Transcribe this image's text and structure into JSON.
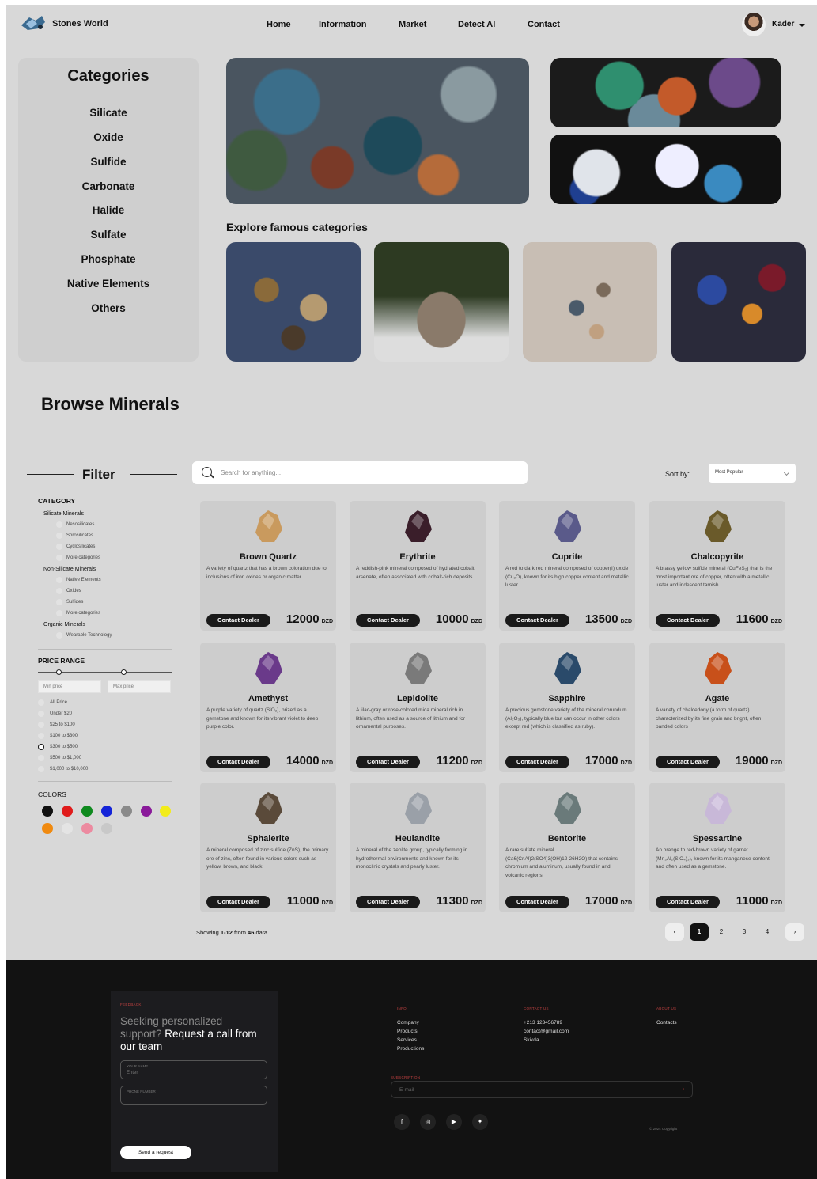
{
  "nav": {
    "brand": "Stones World",
    "links": [
      "Home",
      "Information",
      "Market",
      "Detect AI",
      "Contact"
    ],
    "user": "Kader"
  },
  "categories": {
    "title": "Categories",
    "items": [
      "Silicate",
      "Oxide",
      "Sulfide",
      "Carbonate",
      "Halide",
      "Sulfate",
      "Phosphate",
      "Native Elements",
      "Others"
    ]
  },
  "explore_title": "Explore famous categories",
  "browse_title": "Browse Minerals",
  "filter": {
    "title": "Filter",
    "category_heading": "CATEGORY",
    "groups": [
      {
        "label": "Silicate Minerals",
        "options": [
          "Nesosilicates",
          "Sorosilicates",
          "Cyclosilicates",
          "More categories"
        ]
      },
      {
        "label": "Non-Silicate Minerals",
        "options": [
          "Native Elements",
          "Oxides",
          "Sulfides",
          "More categories"
        ]
      },
      {
        "label": "Organic Minerals",
        "options": [
          "Wearable Technology"
        ]
      }
    ],
    "price_heading": "PRICE RANGE",
    "min_placeholder": "Min price",
    "max_placeholder": "Max price",
    "price_options": [
      "All Price",
      "Under $20",
      "$25 to $100",
      "$100 to $300",
      "$300 to $500",
      "$500 to $1,000",
      "$1,000 to $10,000"
    ],
    "price_selected": 4,
    "colors_heading": "COLORS",
    "colors": [
      "#111111",
      "#e01b1b",
      "#0f8a1f",
      "#1424d8",
      "#8a8a8a",
      "#8a1a9a",
      "#f2ec1a",
      "#f08a10",
      "#e4e4e4",
      "#ec8aa0",
      "#c8c8c8"
    ]
  },
  "search": {
    "placeholder": "Search for anything..."
  },
  "sort": {
    "label": "Sort by:",
    "value": "Most Popular"
  },
  "products": [
    {
      "name": "Brown Quartz",
      "desc": "A variety of quartz that has a brown coloration due to inclusions of iron oxides or organic matter.",
      "button": "Contact Dealer",
      "price": "12000",
      "currency": "DZD",
      "color": "#c99a5e"
    },
    {
      "name": "Erythrite",
      "desc": "A reddish-pink mineral composed of hydrated cobalt arsenate, often associated with cobalt-rich deposits.",
      "button": "Contact Dealer",
      "price": "10000",
      "currency": "DZD",
      "color": "#3a1e2a"
    },
    {
      "name": "Cuprite",
      "desc": "A red to dark red mineral composed of copper(I) oxide (Cu₂O), known for its high copper content and metallic luster.",
      "button": "Contact Dealer",
      "price": "13500",
      "currency": "DZD",
      "color": "#5a5a8a"
    },
    {
      "name": "Chalcopyrite",
      "desc": "A brassy yellow sulfide mineral (CuFeS₂) that is the most important ore of copper, often with a metallic luster and iridescent tarnish.",
      "button": "Contact Dealer",
      "price": "11600",
      "currency": "DZD",
      "color": "#6a5a2a"
    },
    {
      "name": "Amethyst",
      "desc": "A purple variety of quartz (SiO₂), prized as a gemstone and known for its vibrant violet to deep purple color.",
      "button": "Contact Dealer",
      "price": "14000",
      "currency": "DZD",
      "color": "#6a3a8a"
    },
    {
      "name": "Lepidolite",
      "desc": "A lilac-gray or rose-colored mica mineral rich in lithium, often used as a source of lithium and for ornamental purposes.",
      "button": "Contact Dealer",
      "price": "11200",
      "currency": "DZD",
      "color": "#7a7a7a"
    },
    {
      "name": "Sapphire",
      "desc": "A precious gemstone variety of the mineral corundum (Al₂O₃), typically blue but can occur in other colors except red (which is classified as ruby).",
      "button": "Contact Dealer",
      "price": "17000",
      "currency": "DZD",
      "color": "#2a4a6a"
    },
    {
      "name": "Agate",
      "desc": "A variety of chalcedony (a form of quartz) characterized by its fine grain and bright, often banded colors",
      "button": "Contact Dealer",
      "price": "19000",
      "currency": "DZD",
      "color": "#c8501a"
    },
    {
      "name": "Sphalerite",
      "desc": "A mineral composed of zinc sulfide (ZnS), the primary ore of zinc, often found in various colors such as yellow, brown, and black",
      "button": "Contact Dealer",
      "price": "11000",
      "currency": "DZD",
      "color": "#5a4a3a"
    },
    {
      "name": "Heulandite",
      "desc": "A mineral of the zeolite group, typically forming in hydrothermal environments and known for its monoclinic crystals and pearly luster.",
      "button": "Contact Dealer",
      "price": "11300",
      "currency": "DZD",
      "color": "#9aa0a8"
    },
    {
      "name": "Bentorite",
      "desc": "A rare sulfate mineral (Ca6(Cr,Al)2(SO4)3(OH)12·26H2O) that contains chromium and aluminum, usually found in arid, volcanic regions.",
      "button": "Contact Dealer",
      "price": "17000",
      "currency": "DZD",
      "color": "#6a7a7a"
    },
    {
      "name": "Spessartine",
      "desc": "An orange to red-brown variety of garnet (Mn₃Al₂(SiO₄)₃), known for its manganese content and often used as a gemstone.",
      "button": "Contact Dealer",
      "price": "11000",
      "currency": "DZD",
      "color": "#c8b8d8"
    }
  ],
  "pagination": {
    "showing_prefix": "Showing ",
    "range": "1-12",
    "from": " from ",
    "total": "46",
    "suffix": " data",
    "pages": [
      "1",
      "2",
      "3",
      "4"
    ],
    "prev": "‹",
    "next": "›"
  },
  "footer": {
    "feedback_label": "FEEDBACK",
    "title_gray": "Seeking personalized support?",
    "title_white": " Request a call from our team",
    "name_label": "YOUR NAME",
    "name_value": "Enter",
    "phone_label": "PHONE NUMBER",
    "send": "Send a request",
    "info_label": "INFO",
    "info": [
      "Company",
      "Products",
      "Services",
      "Productions"
    ],
    "contact_label": "CONTACT US",
    "contact": [
      "+213 123456789",
      "contact@gmail.com",
      "Skikda"
    ],
    "about_label": "ABOUT US",
    "about": [
      "Contacts"
    ],
    "subscription_label": "SUBSCRIPTION",
    "email_placeholder": "E-mail",
    "copyright": "© 2024     Copyright"
  }
}
